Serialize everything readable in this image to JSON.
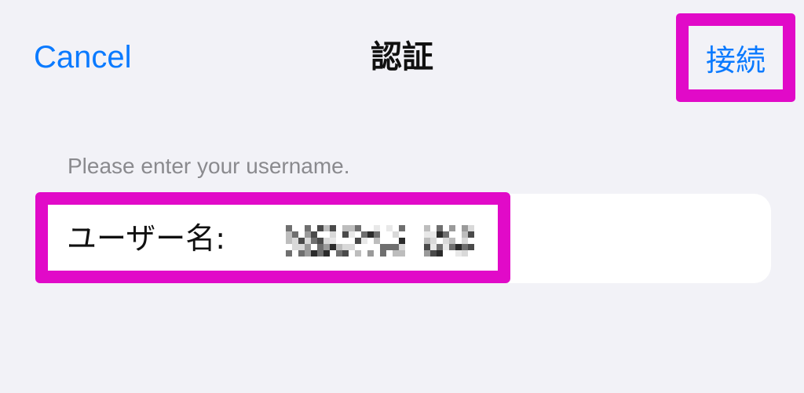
{
  "nav": {
    "cancel_label": "Cancel",
    "title": "認証",
    "connect_label": "接続"
  },
  "form": {
    "header": "Please enter your username.",
    "username_label": "ユーザー名:",
    "username_value_hint": "redacted-username"
  },
  "colors": {
    "accent": "#0a7aff",
    "highlight": "#e10ac8",
    "background": "#f2f2f7",
    "row_background": "#ffffff",
    "secondary_text": "#8a8a8e"
  }
}
